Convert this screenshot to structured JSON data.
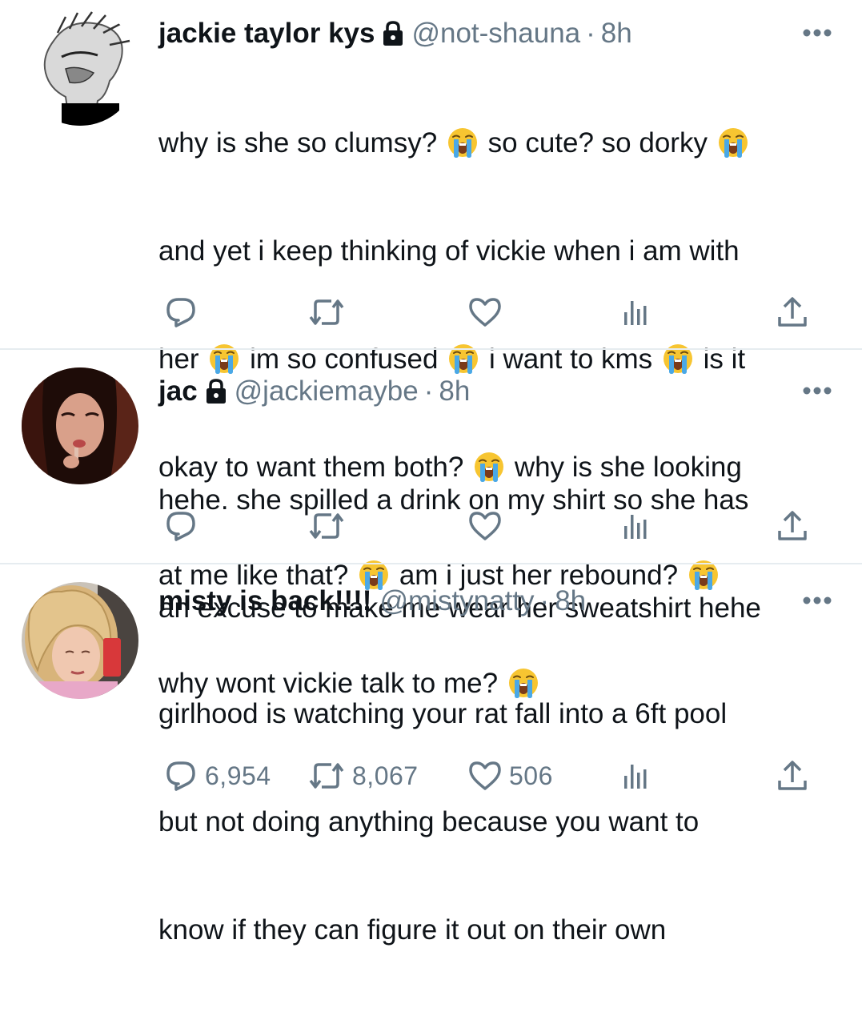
{
  "colors": {
    "text_primary": "#0f1419",
    "text_secondary": "#657786",
    "divider": "#e6ecf0",
    "emoji_face": "#f7c531",
    "emoji_tear": "#4aa8e6"
  },
  "icons": {
    "lock": "lock-icon",
    "more": "more-horizontal-icon",
    "reply": "reply-icon",
    "retweet": "retweet-icon",
    "like": "heart-icon",
    "analytics": "analytics-icon",
    "share": "share-icon",
    "emoji": "loudly-crying-face-emoji"
  },
  "tweets": [
    {
      "display_name": "jackie taylor kys",
      "handle": "@not-shauna",
      "separator": "·",
      "time": "8h",
      "protected": true,
      "text_lines": [
        [
          "why is she so clumsy?",
          "so cute? so dorky",
          ""
        ],
        [
          "and yet i keep thinking of vickie when i am with"
        ],
        [
          "her",
          "im so confused",
          "i want to kms",
          "is it"
        ],
        [
          "okay to want them both?",
          "why is she looking"
        ],
        [
          "at me like that?",
          "am i just her rebound?",
          ""
        ],
        [
          "why wont vickie talk to me?",
          ""
        ]
      ],
      "reply_count": "",
      "retweet_count": "",
      "like_count": ""
    },
    {
      "display_name": "jac",
      "handle": "@jackiemaybe",
      "separator": "·",
      "time": "8h",
      "protected": true,
      "text_lines": [
        "hehe. she spilled a drink on my shirt so she has",
        "an excuse to make me wear her sweatshirt hehe"
      ],
      "reply_count": "",
      "retweet_count": "",
      "like_count": ""
    },
    {
      "display_name": "misty is back!!!!",
      "handle": "@mistynatty",
      "separator": "·",
      "time": "8h",
      "protected": false,
      "text_lines": [
        "girlhood is watching your rat fall into a 6ft pool",
        "but not doing anything because you want to",
        "know if they can figure it out on their own"
      ],
      "reply_count": "6,954",
      "retweet_count": "8,067",
      "like_count": "506"
    }
  ]
}
